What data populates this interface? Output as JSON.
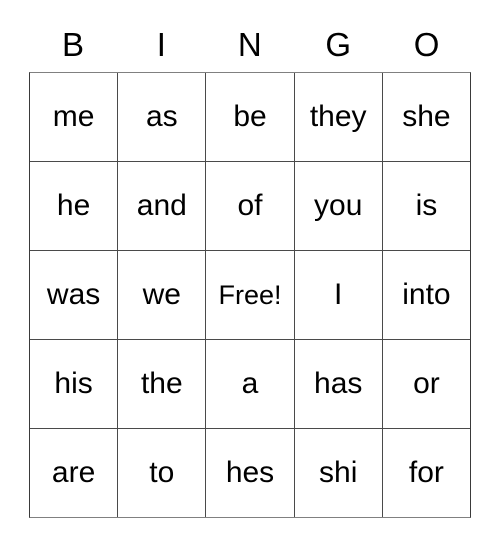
{
  "card": {
    "title": "BINGO",
    "headers": [
      "B",
      "I",
      "N",
      "G",
      "O"
    ],
    "free_space_label": "Free!",
    "rows": [
      {
        "cells": [
          "me",
          "as",
          "be",
          "they",
          "she"
        ]
      },
      {
        "cells": [
          "he",
          "and",
          "of",
          "you",
          "is"
        ]
      },
      {
        "cells": [
          "was",
          "we",
          "Free!",
          "I",
          "into"
        ]
      },
      {
        "cells": [
          "his",
          "the",
          "a",
          "has",
          "or"
        ]
      },
      {
        "cells": [
          "are",
          "to",
          "hes",
          "shi",
          "for"
        ]
      }
    ],
    "colors": {
      "background": "#ffffff",
      "text": "#000000",
      "grid_line": "#4a4a4a",
      "grid_outer": "#808080"
    }
  }
}
